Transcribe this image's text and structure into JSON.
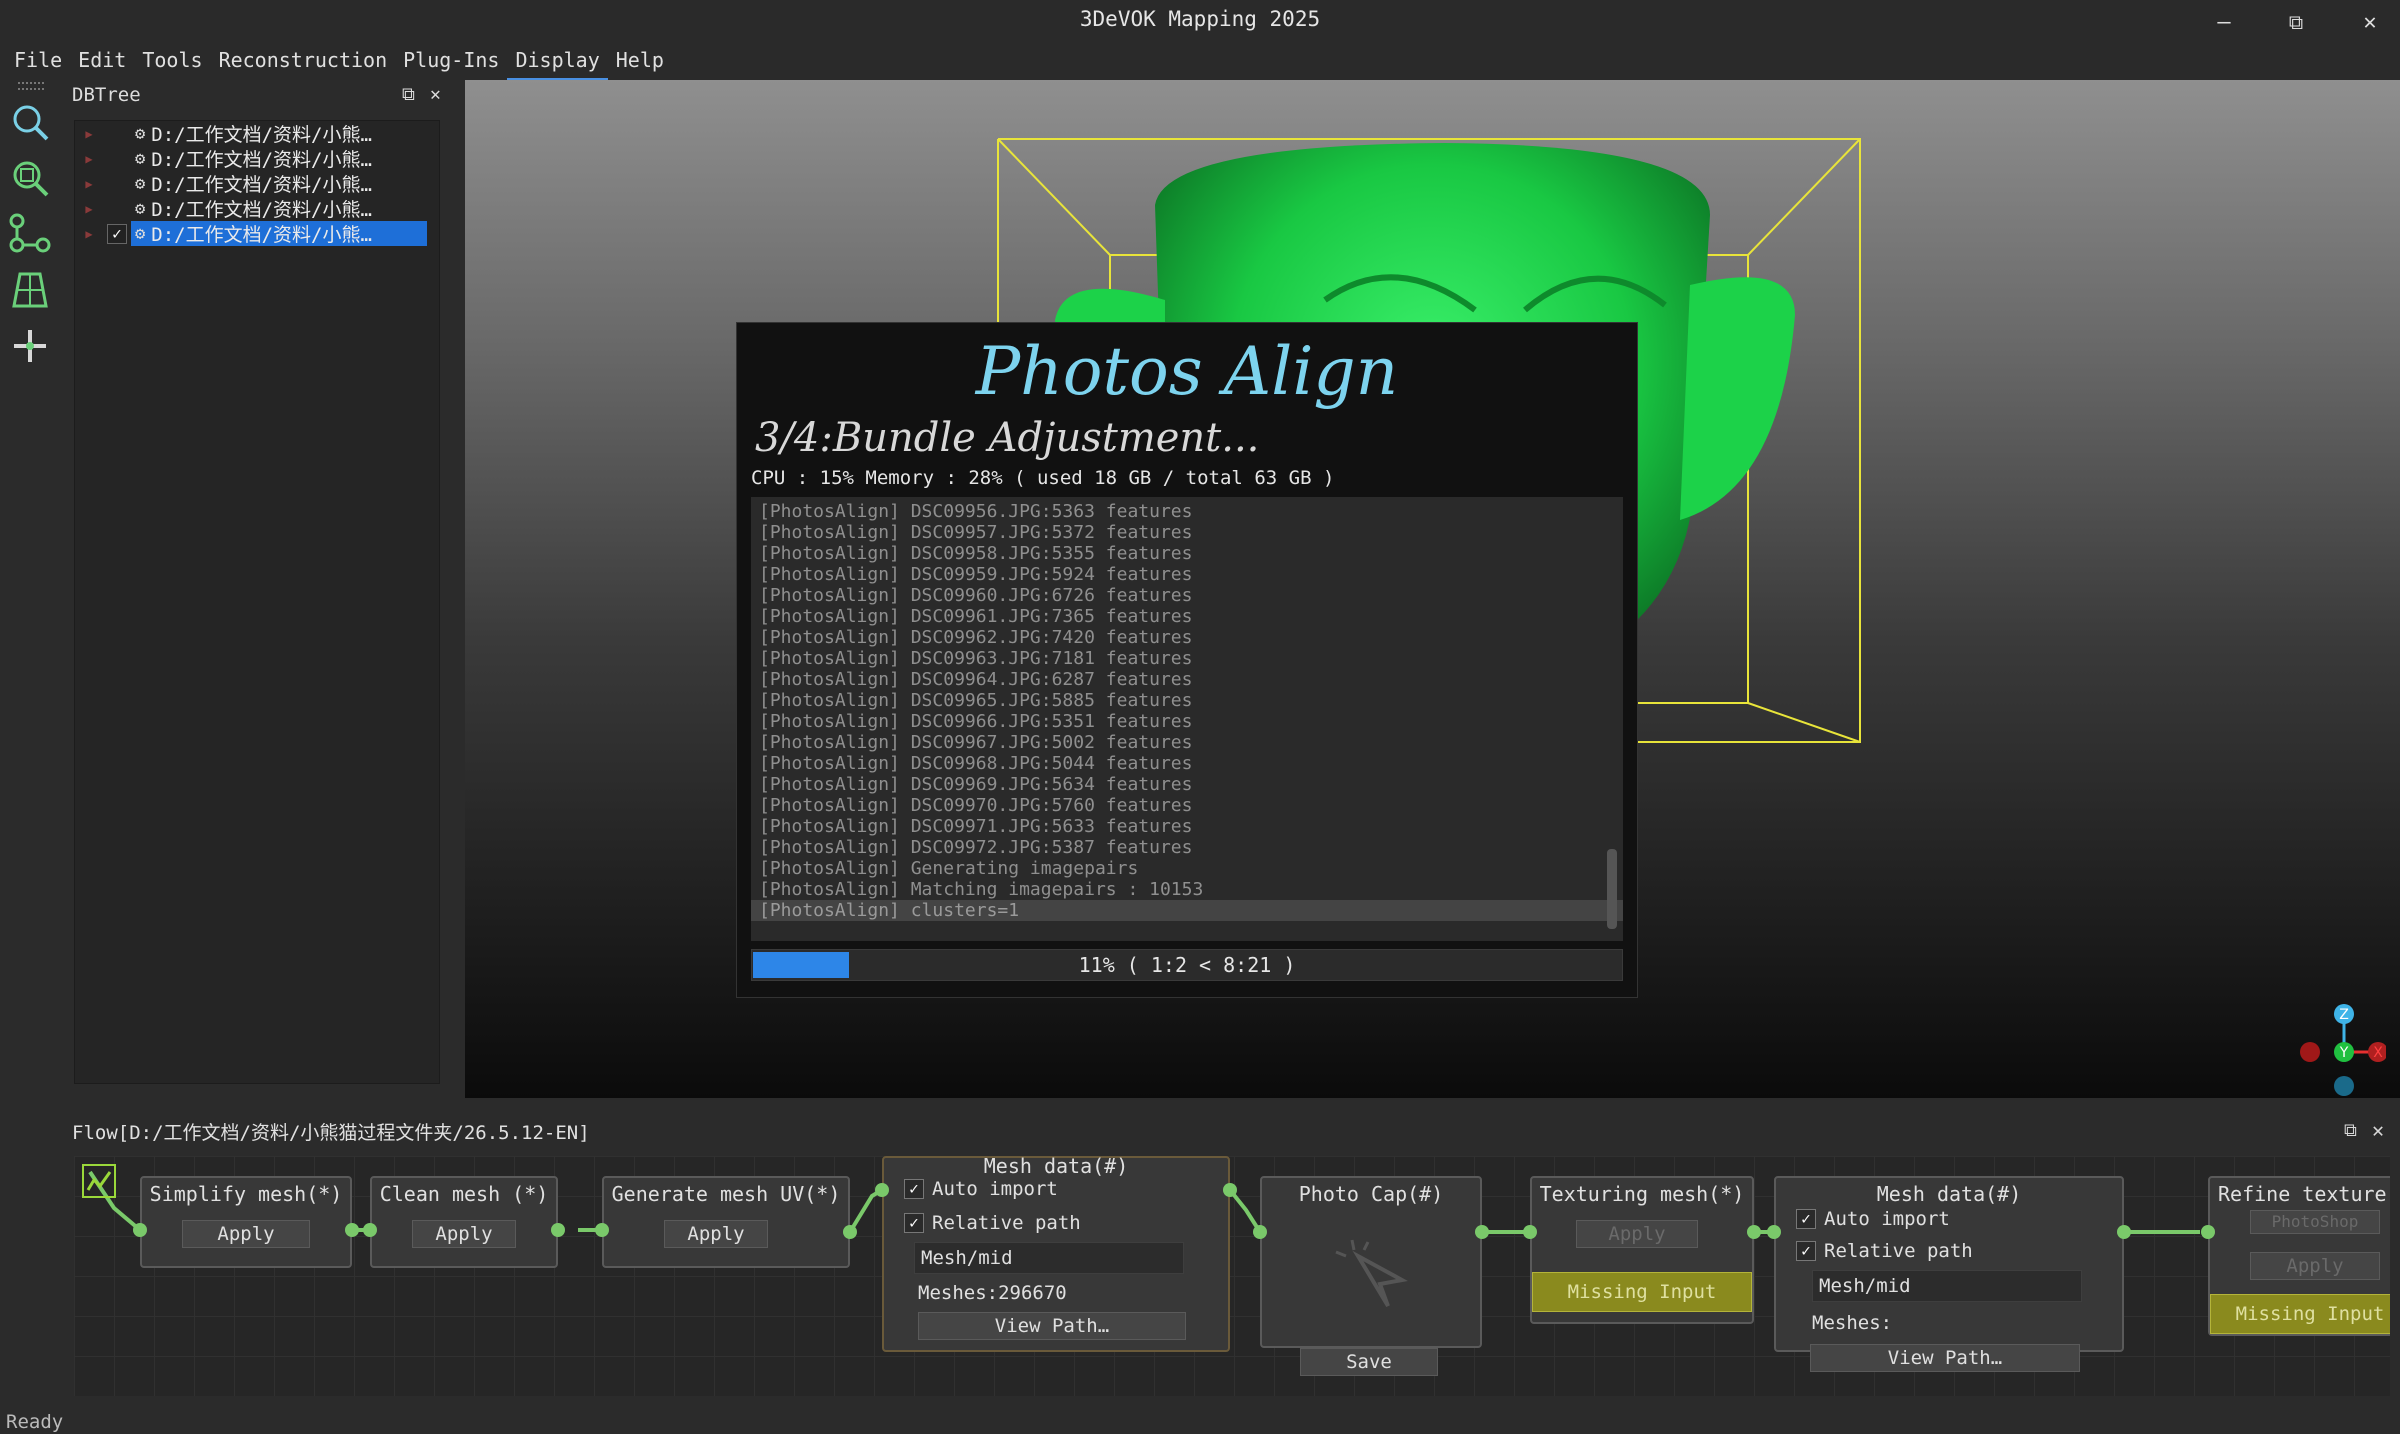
{
  "window": {
    "title": "3DeVOK Mapping 2025",
    "minimize_glyph": "—",
    "restore_glyph": "⧉",
    "close_glyph": "✕"
  },
  "menu": [
    "File",
    "Edit",
    "Tools",
    "Reconstruction",
    "Plug-Ins",
    "Display",
    "Help"
  ],
  "toolbar_icons": [
    "search-icon",
    "zoom-fit-icon",
    "nodes-icon",
    "grid-icon",
    "move-icon"
  ],
  "dbtree": {
    "title": "DBTree",
    "items": [
      {
        "label": "D:/工作文档/资料/小熊…",
        "checked": false,
        "selected": false
      },
      {
        "label": "D:/工作文档/资料/小熊…",
        "checked": false,
        "selected": false
      },
      {
        "label": "D:/工作文档/资料/小熊…",
        "checked": false,
        "selected": false
      },
      {
        "label": "D:/工作文档/资料/小熊…",
        "checked": false,
        "selected": false
      },
      {
        "label": "D:/工作文档/资料/小熊…",
        "checked": true,
        "selected": true
      }
    ]
  },
  "dialog": {
    "title": "Photos Align",
    "step": "3/4:Bundle Adjustment...",
    "stats": "CPU : 15%  Memory : 28% ( used 18 GB / total 63 GB )",
    "log": [
      "[PhotosAlign] DSC09956.JPG:5363 features",
      "[PhotosAlign] DSC09957.JPG:5372 features",
      "[PhotosAlign] DSC09958.JPG:5355 features",
      "[PhotosAlign] DSC09959.JPG:5924 features",
      "[PhotosAlign] DSC09960.JPG:6726 features",
      "[PhotosAlign] DSC09961.JPG:7365 features",
      "[PhotosAlign] DSC09962.JPG:7420 features",
      "[PhotosAlign] DSC09963.JPG:7181 features",
      "[PhotosAlign] DSC09964.JPG:6287 features",
      "[PhotosAlign] DSC09965.JPG:5885 features",
      "[PhotosAlign] DSC09966.JPG:5351 features",
      "[PhotosAlign] DSC09967.JPG:5002 features",
      "[PhotosAlign] DSC09968.JPG:5044 features",
      "[PhotosAlign] DSC09969.JPG:5634 features",
      "[PhotosAlign] DSC09970.JPG:5760 features",
      "[PhotosAlign] DSC09971.JPG:5633 features",
      "[PhotosAlign] DSC09972.JPG:5387 features",
      "[PhotosAlign] Generating imagepairs",
      "[PhotosAlign] Matching imagepairs : 10153",
      "[PhotosAlign] clusters=1"
    ],
    "progress_fraction": 0.11,
    "progress_text": "11% ( 1:2 < 8:21 )"
  },
  "axes": {
    "z": "Z",
    "y": "Y",
    "x": "X"
  },
  "flow": {
    "title": "Flow[D:/工作文档/资料/小熊猫过程文件夹/26.5.12-EN]",
    "apply_label": "Apply",
    "missing_label": "Missing Input",
    "auto_import": "Auto import",
    "relative_path": "Relative path",
    "mesh_path": "Mesh/mid",
    "view_path": "View Path…",
    "save": "Save",
    "nodes": {
      "simplify": "Simplify mesh(*)",
      "clean": "Clean mesh (*)",
      "uv": "Generate mesh UV(*)",
      "meshdata1": "Mesh data(#)",
      "meshdata1_meshes": "Meshes:296670",
      "photocap": "Photo Cap(#)",
      "texturing": "Texturing mesh(*)",
      "meshdata2": "Mesh data(#)",
      "meshdata2_meshes": "Meshes:",
      "refine": "Refine texture",
      "refine_option": "PhotoShop"
    }
  },
  "status": "Ready",
  "colors": {
    "accent": "#2d86e8",
    "model": "#1fd24a",
    "bbox": "#e8e43a",
    "missing": "#8a8a1e"
  }
}
